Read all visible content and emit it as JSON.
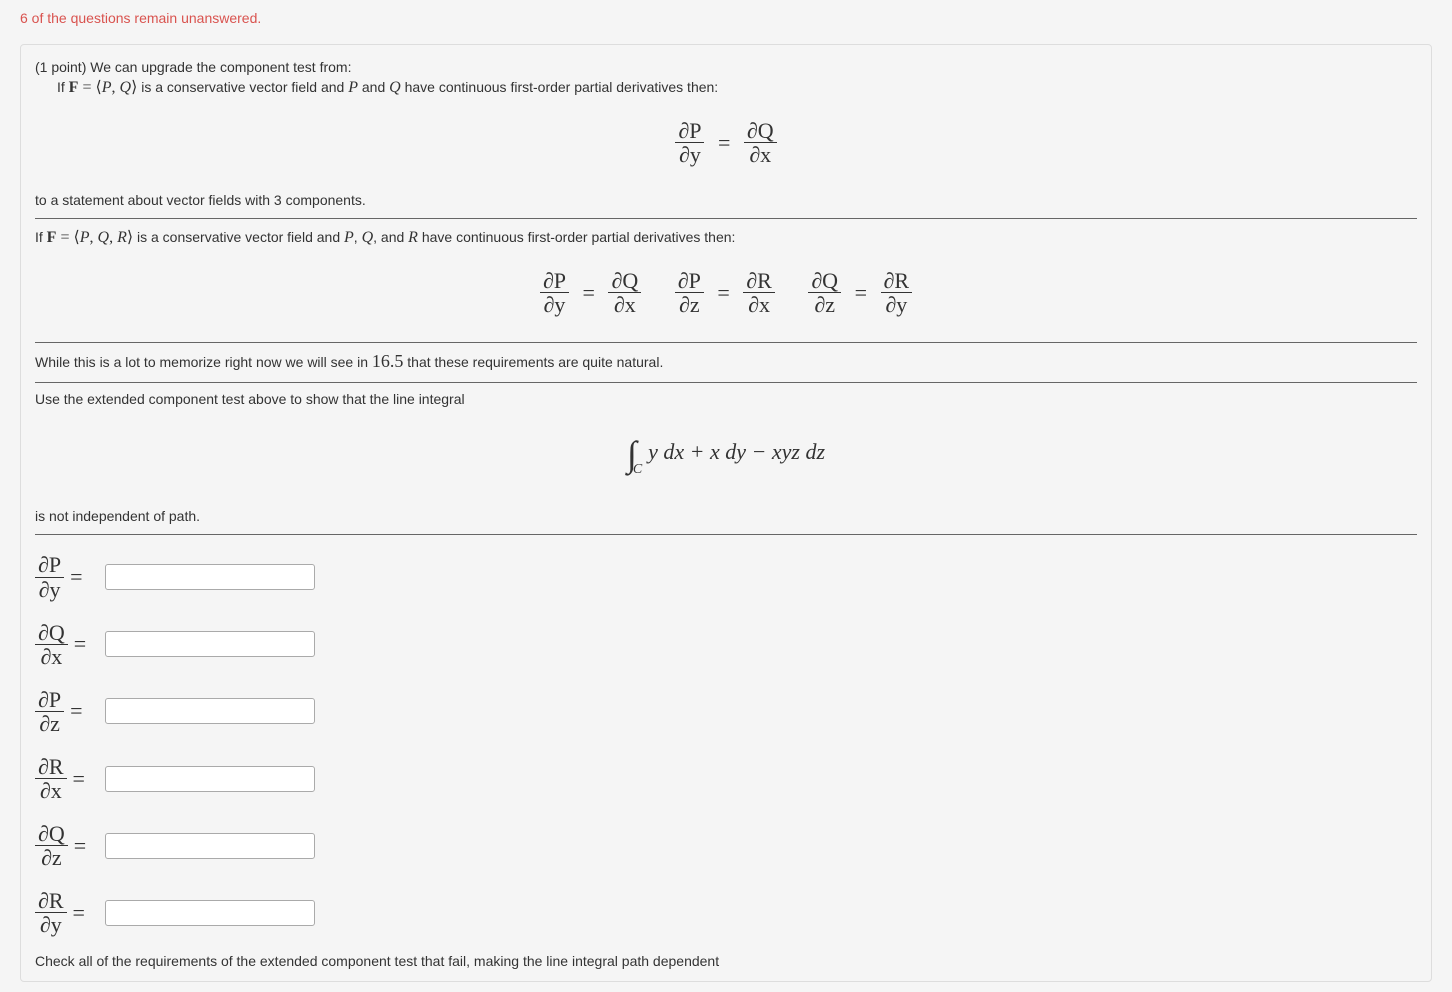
{
  "warning_text": "6 of the questions remain unanswered.",
  "problem": {
    "points_prefix": "(1 point) ",
    "intro": "We can upgrade the component test from:",
    "if_2d_before": "If ",
    "if_2d_mid1": " is a conservative vector field and ",
    "if_2d_mid2": " and ",
    "if_2d_after": " have continuous first-order partial derivatives then:",
    "eq2d_left_num": "∂P",
    "eq2d_left_den": "∂y",
    "eq2d_right_num": "∂Q",
    "eq2d_right_den": "∂x",
    "bridge": "to a statement about vector fields with 3 components.",
    "if_3d_before": "If ",
    "if_3d_mid1": " is a conservative vector field and ",
    "if_3d_list_sep1": ", ",
    "if_3d_list_sep2": ", and ",
    "if_3d_after": " have continuous first-order partial derivatives then:",
    "eq3d": {
      "a_num": "∂P",
      "a_den": "∂y",
      "b_num": "∂Q",
      "b_den": "∂x",
      "c_num": "∂P",
      "c_den": "∂z",
      "d_num": "∂R",
      "d_den": "∂x",
      "e_num": "∂Q",
      "e_den": "∂z",
      "f_num": "∂R",
      "f_den": "∂y"
    },
    "memorize_before": "While this is a lot to memorize right now we will see in ",
    "memorize_section": "16.5",
    "memorize_after": " that these requirements are quite natural.",
    "use_test": "Use the extended component test above to show that the line integral",
    "integral_body": "y dx + x dy − xyz dz",
    "integral_sub": "C",
    "not_indep": "is not independent of path.",
    "answers": [
      {
        "num": "∂P",
        "den": "∂y"
      },
      {
        "num": "∂Q",
        "den": "∂x"
      },
      {
        "num": "∂P",
        "den": "∂z"
      },
      {
        "num": "∂R",
        "den": "∂x"
      },
      {
        "num": "∂Q",
        "den": "∂z"
      },
      {
        "num": "∂R",
        "den": "∂y"
      }
    ],
    "check_all": "Check all of the requirements of the extended component test that fail, making the line integral path dependent",
    "vec_F": "F",
    "sym_P": "P",
    "sym_Q": "Q",
    "sym_R": "R",
    "angle_open": "⟨",
    "angle_close": "⟩",
    "comma": ", ",
    "equals": " = "
  }
}
